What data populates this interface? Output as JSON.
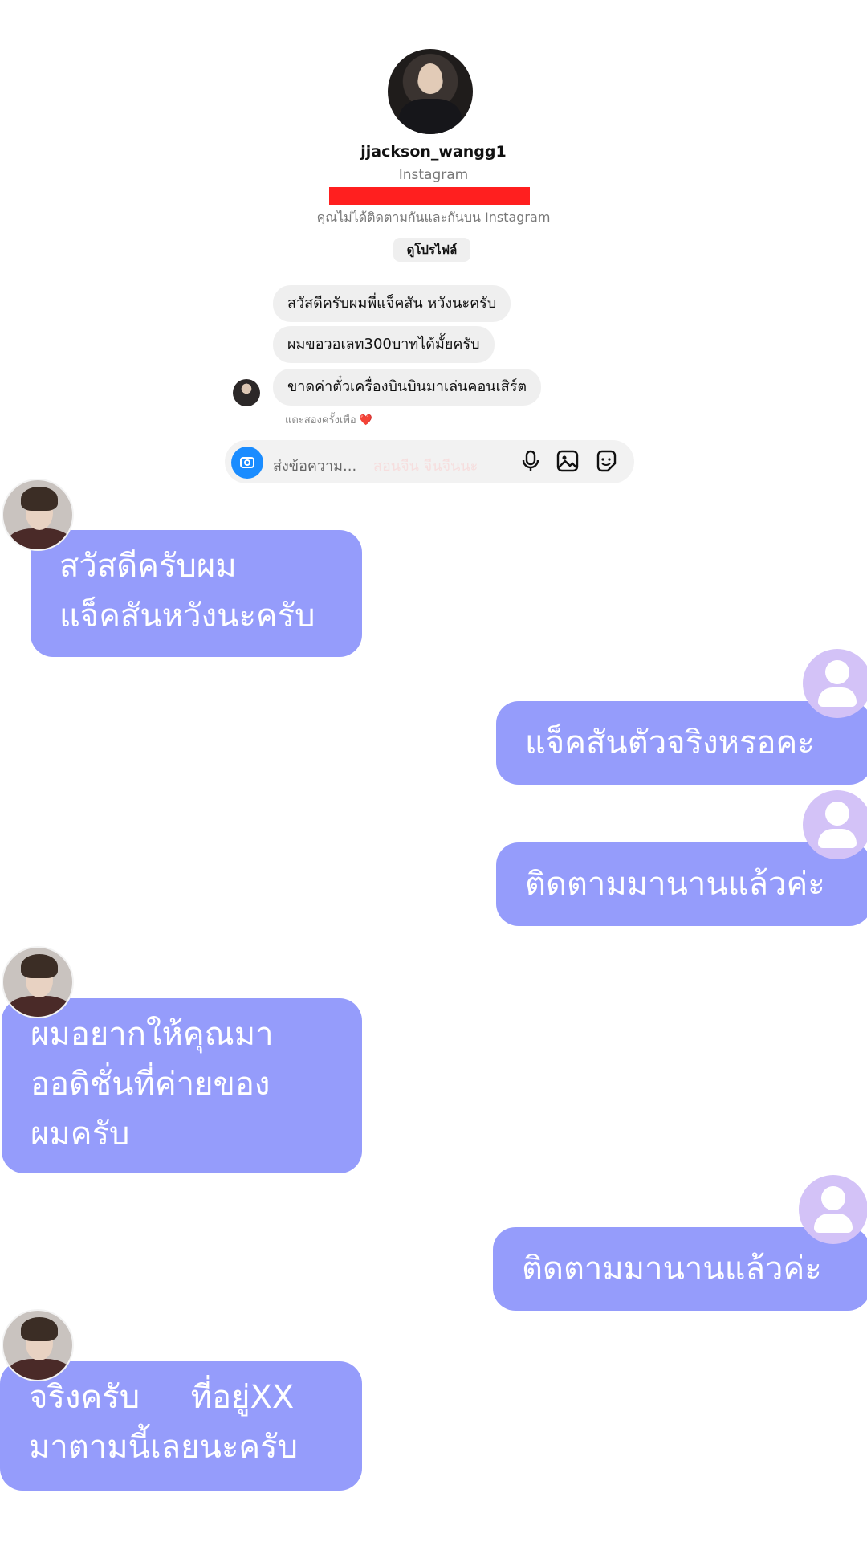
{
  "instagram_screenshot": {
    "username": "jjackson_wangg1",
    "app_label": "Instagram",
    "follow_info": "คุณไม่ได้ติดตามกันและกันบน Instagram",
    "view_profile_label": "ดูโปรไฟล์",
    "messages": [
      "สวัสดีครับผมพี่แจ็คสัน หวังนะครับ",
      "ผมขอวอเลท300บาทได้มั้ยครับ",
      "ขาดค่าตั๋วเครื่องบินบินมาเล่นคอนเสิร์ต"
    ],
    "tap_hint": "แตะสองครั้งเพื่อ",
    "heart": "❤️",
    "input_placeholder": "ส่งข้อความ...",
    "input_ghost_text": "สอนจีน จีนจีนนะ",
    "red_bar_color": "#ff1f1f"
  },
  "chat": {
    "accent_color": "#959cfb",
    "messages": [
      {
        "sender": "jackson",
        "lines": [
          "สวัสดีครับผม",
          "แจ็คสันหวังนะครับ"
        ]
      },
      {
        "sender": "user",
        "lines": [
          "แจ็คสันตัวจริงหรอคะ"
        ]
      },
      {
        "sender": "user",
        "lines": [
          "ติดตามมานานแล้วค่ะ"
        ]
      },
      {
        "sender": "jackson",
        "lines": [
          "ผมอยากให้คุณมา",
          "ออดิชั่นที่ค่ายของ",
          "ผมครับ"
        ]
      },
      {
        "sender": "user",
        "lines": [
          "ติดตามมานานแล้วค่ะ"
        ]
      },
      {
        "sender": "jackson",
        "lines": [
          "จริงครับ     ที่อยู่XX",
          "มาตามนี้เลยนะครับ"
        ]
      }
    ]
  }
}
